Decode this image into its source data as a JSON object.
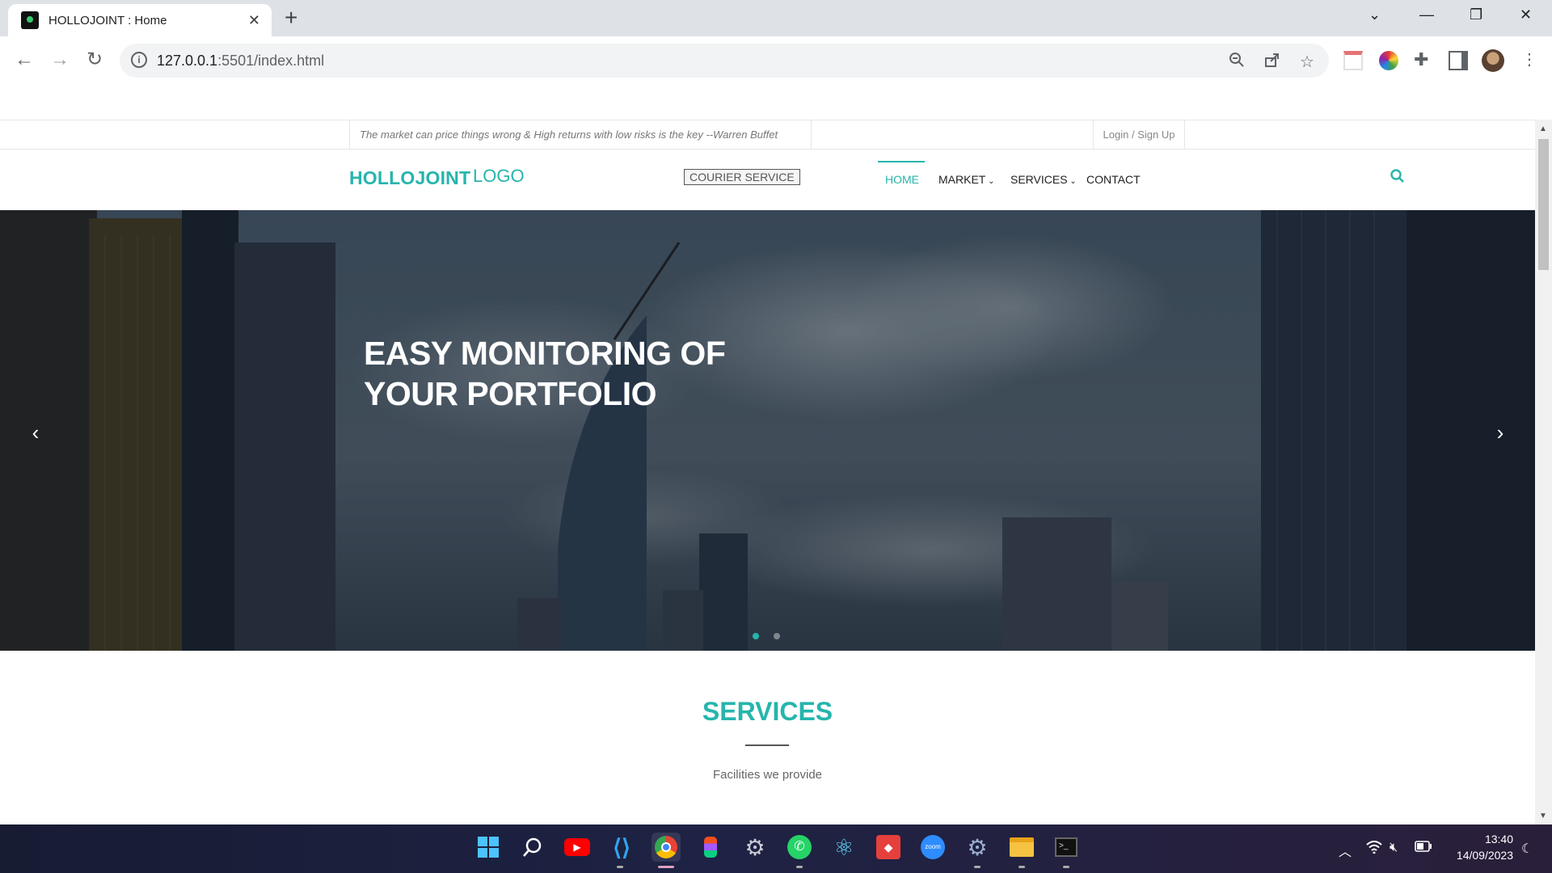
{
  "browser": {
    "tab_title": "HOLLOJOINT : Home",
    "url_host": "127.0.0.1",
    "url_rest": ":5501/index.html"
  },
  "site": {
    "quote": "The market can price things wrong  &  High returns with low risks is the key   --Warren Buffet",
    "login": "Login / Sign Up",
    "brand": "HOLLOJOINT",
    "logo_alt": "LOGO",
    "courier": "COURIER SERVICE",
    "menu": {
      "home": "HOME",
      "market": "MARKET",
      "services": "SERVICES",
      "contact": "CONTACT"
    },
    "hero_title": "EASY MONITORING OF YOUR PORTFOLIO",
    "services_title": "SERVICES",
    "services_subtitle": "Facilities we provide"
  },
  "taskbar": {
    "time": "13:40",
    "date": "14/09/2023",
    "zoom_label": "zoom"
  },
  "colors": {
    "accent": "#26b5ac",
    "taskbar": "#1e2244"
  }
}
